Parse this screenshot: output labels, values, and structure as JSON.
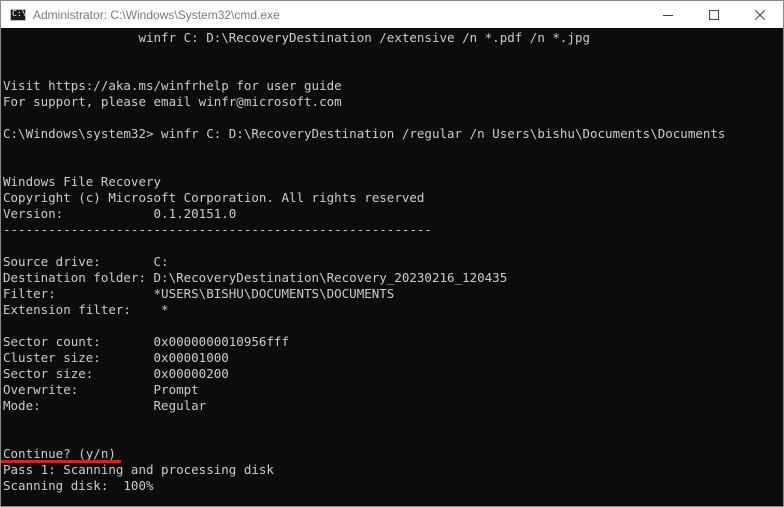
{
  "window": {
    "title": "Administrator: C:\\Windows\\System32\\cmd.exe",
    "app_icon": "cmd-icon",
    "app_icon_glyph": "C:\\",
    "controls": [
      "minimize-icon",
      "maximize-icon",
      "close-icon"
    ]
  },
  "console": {
    "text_color": "#cccccc",
    "background": "#0c0c0c",
    "highlight_color": "#d6202a",
    "lines": {
      "l01": "                  winfr C: D:\\RecoveryDestination /extensive /n *.pdf /n *.jpg",
      "l02": "",
      "l03": "",
      "l04": "Visit https://aka.ms/winfrhelp for user guide",
      "l05": "For support, please email winfr@microsoft.com",
      "l06": "",
      "l07": "C:\\Windows\\system32> winfr C: D:\\RecoveryDestination /regular /n Users\\bishu\\Documents\\Documents",
      "l08": "",
      "l09": "",
      "l10": "Windows File Recovery",
      "l11": "Copyright (c) Microsoft Corporation. All rights reserved",
      "l12": "Version:            0.1.20151.0",
      "l13": "---------------------------------------------------------",
      "l14": "",
      "l15": "Source drive:       C:",
      "l16": "Destination folder: D:\\RecoveryDestination\\Recovery_20230216_120435",
      "l17": "Filter:             *USERS\\BISHU\\DOCUMENTS\\DOCUMENTS",
      "l18": "Extension filter:    *",
      "l19": "",
      "l20": "Sector count:       0x0000000010956fff",
      "l21": "Cluster size:       0x00001000",
      "l22": "Sector size:        0x00000200",
      "l23": "Overwrite:          Prompt",
      "l24": "Mode:               Regular",
      "l25": "",
      "l26": "",
      "l27": "Continue? (y/n)",
      "l28": "Pass 1: Scanning and processing disk",
      "l29": "Scanning disk:  100%"
    }
  }
}
